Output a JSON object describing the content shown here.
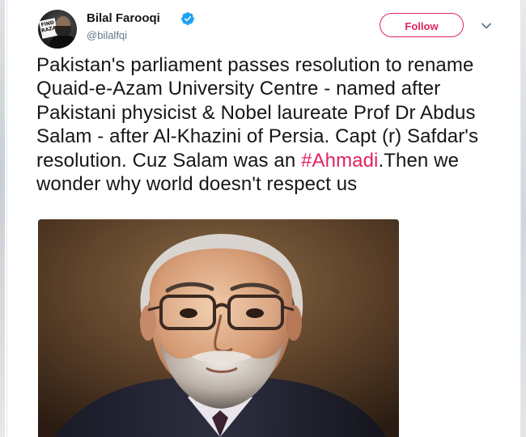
{
  "user": {
    "display_name": "Bilal Farooqi",
    "handle": "@bilalfqi",
    "verified": true,
    "avatar_sign_text": "FIND RAZA"
  },
  "actions": {
    "follow_label": "Follow",
    "more_icon": "chevron-down-icon"
  },
  "tweet": {
    "text_before_hashtag": "Pakistan's parliament passes resolution to rename Quaid-e-Azam University Centre - named after Pakistani physicist & Nobel laureate Prof Dr Abdus Salam - after Al-Khazini of Persia. Capt (r) Safdar's resolution. Cuz Salam was an ",
    "hashtag": "#Ahmadi",
    "text_after_hashtag": ".Then we wonder why world doesn't respect us"
  },
  "colors": {
    "accent": "#e0245e",
    "verified": "#1da1f2",
    "text": "#14171a",
    "secondary_text": "#657786"
  }
}
